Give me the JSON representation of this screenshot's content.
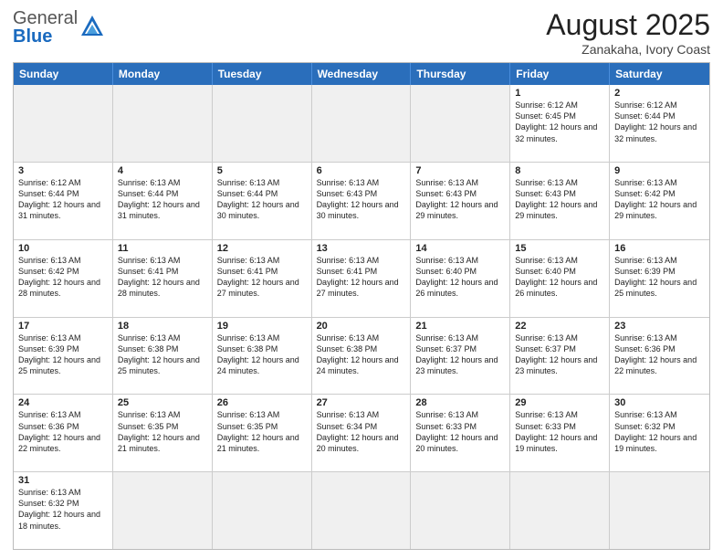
{
  "header": {
    "logo_general": "General",
    "logo_blue": "Blue",
    "month_title": "August 2025",
    "subtitle": "Zanakaha, Ivory Coast"
  },
  "weekdays": [
    "Sunday",
    "Monday",
    "Tuesday",
    "Wednesday",
    "Thursday",
    "Friday",
    "Saturday"
  ],
  "weeks": [
    [
      {
        "day": "",
        "info": "",
        "empty": true
      },
      {
        "day": "",
        "info": "",
        "empty": true
      },
      {
        "day": "",
        "info": "",
        "empty": true
      },
      {
        "day": "",
        "info": "",
        "empty": true
      },
      {
        "day": "",
        "info": "",
        "empty": true
      },
      {
        "day": "1",
        "info": "Sunrise: 6:12 AM\nSunset: 6:45 PM\nDaylight: 12 hours\nand 32 minutes.",
        "empty": false
      },
      {
        "day": "2",
        "info": "Sunrise: 6:12 AM\nSunset: 6:44 PM\nDaylight: 12 hours\nand 32 minutes.",
        "empty": false
      }
    ],
    [
      {
        "day": "3",
        "info": "Sunrise: 6:12 AM\nSunset: 6:44 PM\nDaylight: 12 hours\nand 31 minutes.",
        "empty": false
      },
      {
        "day": "4",
        "info": "Sunrise: 6:13 AM\nSunset: 6:44 PM\nDaylight: 12 hours\nand 31 minutes.",
        "empty": false
      },
      {
        "day": "5",
        "info": "Sunrise: 6:13 AM\nSunset: 6:44 PM\nDaylight: 12 hours\nand 30 minutes.",
        "empty": false
      },
      {
        "day": "6",
        "info": "Sunrise: 6:13 AM\nSunset: 6:43 PM\nDaylight: 12 hours\nand 30 minutes.",
        "empty": false
      },
      {
        "day": "7",
        "info": "Sunrise: 6:13 AM\nSunset: 6:43 PM\nDaylight: 12 hours\nand 29 minutes.",
        "empty": false
      },
      {
        "day": "8",
        "info": "Sunrise: 6:13 AM\nSunset: 6:43 PM\nDaylight: 12 hours\nand 29 minutes.",
        "empty": false
      },
      {
        "day": "9",
        "info": "Sunrise: 6:13 AM\nSunset: 6:42 PM\nDaylight: 12 hours\nand 29 minutes.",
        "empty": false
      }
    ],
    [
      {
        "day": "10",
        "info": "Sunrise: 6:13 AM\nSunset: 6:42 PM\nDaylight: 12 hours\nand 28 minutes.",
        "empty": false
      },
      {
        "day": "11",
        "info": "Sunrise: 6:13 AM\nSunset: 6:41 PM\nDaylight: 12 hours\nand 28 minutes.",
        "empty": false
      },
      {
        "day": "12",
        "info": "Sunrise: 6:13 AM\nSunset: 6:41 PM\nDaylight: 12 hours\nand 27 minutes.",
        "empty": false
      },
      {
        "day": "13",
        "info": "Sunrise: 6:13 AM\nSunset: 6:41 PM\nDaylight: 12 hours\nand 27 minutes.",
        "empty": false
      },
      {
        "day": "14",
        "info": "Sunrise: 6:13 AM\nSunset: 6:40 PM\nDaylight: 12 hours\nand 26 minutes.",
        "empty": false
      },
      {
        "day": "15",
        "info": "Sunrise: 6:13 AM\nSunset: 6:40 PM\nDaylight: 12 hours\nand 26 minutes.",
        "empty": false
      },
      {
        "day": "16",
        "info": "Sunrise: 6:13 AM\nSunset: 6:39 PM\nDaylight: 12 hours\nand 25 minutes.",
        "empty": false
      }
    ],
    [
      {
        "day": "17",
        "info": "Sunrise: 6:13 AM\nSunset: 6:39 PM\nDaylight: 12 hours\nand 25 minutes.",
        "empty": false
      },
      {
        "day": "18",
        "info": "Sunrise: 6:13 AM\nSunset: 6:38 PM\nDaylight: 12 hours\nand 25 minutes.",
        "empty": false
      },
      {
        "day": "19",
        "info": "Sunrise: 6:13 AM\nSunset: 6:38 PM\nDaylight: 12 hours\nand 24 minutes.",
        "empty": false
      },
      {
        "day": "20",
        "info": "Sunrise: 6:13 AM\nSunset: 6:38 PM\nDaylight: 12 hours\nand 24 minutes.",
        "empty": false
      },
      {
        "day": "21",
        "info": "Sunrise: 6:13 AM\nSunset: 6:37 PM\nDaylight: 12 hours\nand 23 minutes.",
        "empty": false
      },
      {
        "day": "22",
        "info": "Sunrise: 6:13 AM\nSunset: 6:37 PM\nDaylight: 12 hours\nand 23 minutes.",
        "empty": false
      },
      {
        "day": "23",
        "info": "Sunrise: 6:13 AM\nSunset: 6:36 PM\nDaylight: 12 hours\nand 22 minutes.",
        "empty": false
      }
    ],
    [
      {
        "day": "24",
        "info": "Sunrise: 6:13 AM\nSunset: 6:36 PM\nDaylight: 12 hours\nand 22 minutes.",
        "empty": false
      },
      {
        "day": "25",
        "info": "Sunrise: 6:13 AM\nSunset: 6:35 PM\nDaylight: 12 hours\nand 21 minutes.",
        "empty": false
      },
      {
        "day": "26",
        "info": "Sunrise: 6:13 AM\nSunset: 6:35 PM\nDaylight: 12 hours\nand 21 minutes.",
        "empty": false
      },
      {
        "day": "27",
        "info": "Sunrise: 6:13 AM\nSunset: 6:34 PM\nDaylight: 12 hours\nand 20 minutes.",
        "empty": false
      },
      {
        "day": "28",
        "info": "Sunrise: 6:13 AM\nSunset: 6:33 PM\nDaylight: 12 hours\nand 20 minutes.",
        "empty": false
      },
      {
        "day": "29",
        "info": "Sunrise: 6:13 AM\nSunset: 6:33 PM\nDaylight: 12 hours\nand 19 minutes.",
        "empty": false
      },
      {
        "day": "30",
        "info": "Sunrise: 6:13 AM\nSunset: 6:32 PM\nDaylight: 12 hours\nand 19 minutes.",
        "empty": false
      }
    ],
    [
      {
        "day": "31",
        "info": "Sunrise: 6:13 AM\nSunset: 6:32 PM\nDaylight: 12 hours\nand 18 minutes.",
        "empty": false
      },
      {
        "day": "",
        "info": "",
        "empty": true
      },
      {
        "day": "",
        "info": "",
        "empty": true
      },
      {
        "day": "",
        "info": "",
        "empty": true
      },
      {
        "day": "",
        "info": "",
        "empty": true
      },
      {
        "day": "",
        "info": "",
        "empty": true
      },
      {
        "day": "",
        "info": "",
        "empty": true
      }
    ]
  ]
}
